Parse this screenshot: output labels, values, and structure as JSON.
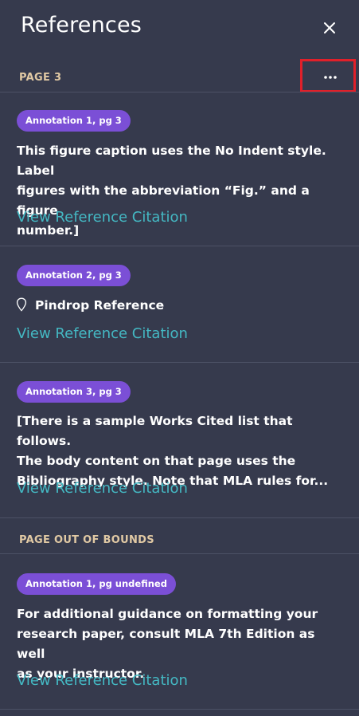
{
  "header": {
    "title": "References",
    "close_icon": "close-icon"
  },
  "sections": [
    {
      "label": "PAGE 3",
      "more_icon": "more-horizontal-icon",
      "items": [
        {
          "badge": "Annotation 1, pg 3",
          "lines": [
            "This figure caption uses the No Indent style. Label",
            "figures with the abbreviation “Fig.” and a figure",
            "number.]"
          ],
          "link": "View Reference Citation"
        },
        {
          "badge": "Annotation 2, pg 3",
          "pin_icon": "map-pin-icon",
          "pin_label": "Pindrop Reference",
          "link": "View Reference Citation"
        },
        {
          "badge": "Annotation 3, pg 3",
          "lines": [
            "[There is a sample Works Cited list that follows.",
            "The body content on that page uses the",
            "Bibliography style. Note that MLA rules for..."
          ],
          "link": "View Reference Citation"
        }
      ]
    },
    {
      "label": "PAGE OUT OF BOUNDS",
      "items": [
        {
          "badge": "Annotation 1, pg undefined",
          "lines": [
            "For additional guidance on formatting your",
            "research paper, consult MLA 7th Edition as well",
            "as your instructor."
          ],
          "link": "View Reference Citation"
        }
      ]
    }
  ],
  "colors": {
    "background": "#363a4d",
    "badge": "#7b4fd6",
    "link": "#44b8c3",
    "section_label": "#e1c9a4",
    "highlight_box": "#e0202a"
  }
}
